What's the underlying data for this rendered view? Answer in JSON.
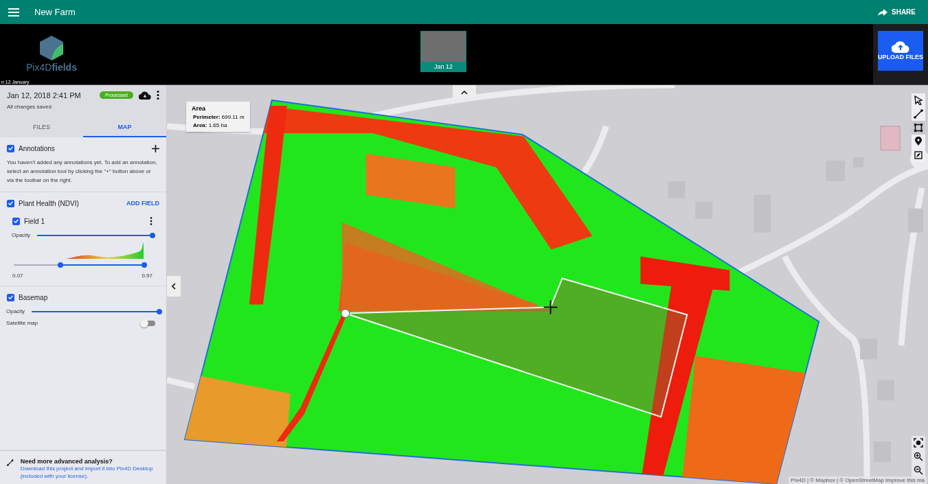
{
  "app_bar": {
    "title": "New Farm",
    "share": "SHARE"
  },
  "header": {
    "logo": "Pix4D**fields**",
    "flights": [
      {
        "label": "Jan 12",
        "selected": true
      }
    ],
    "timeline_label": "n 12 January",
    "upload": "UPLOAD FILES"
  },
  "project": {
    "date": "Jan 12, 2018 2:41 PM",
    "status": "Processed",
    "saved": "All changes saved"
  },
  "tabs": [
    {
      "label": "FILES",
      "selected": false
    },
    {
      "label": "MAP",
      "selected": true
    }
  ],
  "annotations": {
    "label": "Annotations",
    "checked": true,
    "text": "You haven't added any annotations yet. To add an annotation, select an annotation tool by clicking the \"+\" button above or via the toolbar on the right."
  },
  "plant_health": {
    "label": "Plant Health (NDVI)",
    "checked": true,
    "action": "ADD FIELD",
    "field": {
      "label": "Field 1",
      "checked": true,
      "opacity_label": "Opacity",
      "opacity": {
        "level": 1
      },
      "range_low": {
        "level": 0.36
      },
      "range_high": {
        "level": 1
      },
      "min": "0.07",
      "max": "0.97"
    }
  },
  "basemap": {
    "label": "Basemap",
    "checked": true,
    "opacity_label": "Opacity",
    "opacity": {
      "level": 1
    },
    "satellite_label": "Satellite map",
    "satellite_on": false
  },
  "promo": {
    "title": "Need more advanced analysis?",
    "text": "Download this project and import it into Pix4D Desktop (included with your license)."
  },
  "area_popup": {
    "title": "Area",
    "rows": [
      {
        "label": "Perimeter:",
        "value": "699.11 m"
      },
      {
        "label": "Area:",
        "value": "1.65 ha"
      }
    ]
  },
  "tools": [
    {
      "kind": "pointer",
      "selected": false
    },
    {
      "kind": "line",
      "selected": false
    },
    {
      "kind": "polygon",
      "selected": true
    },
    {
      "kind": "pin",
      "selected": false
    },
    {
      "kind": "boundary",
      "selected": false
    }
  ],
  "zoom_controls": [
    {
      "kind": "focus"
    },
    {
      "kind": "zoom_in"
    },
    {
      "kind": "zoom_out"
    }
  ],
  "attribution": "Pix4D | © Mapbox | © OpenStreetMap Improve this ma"
}
